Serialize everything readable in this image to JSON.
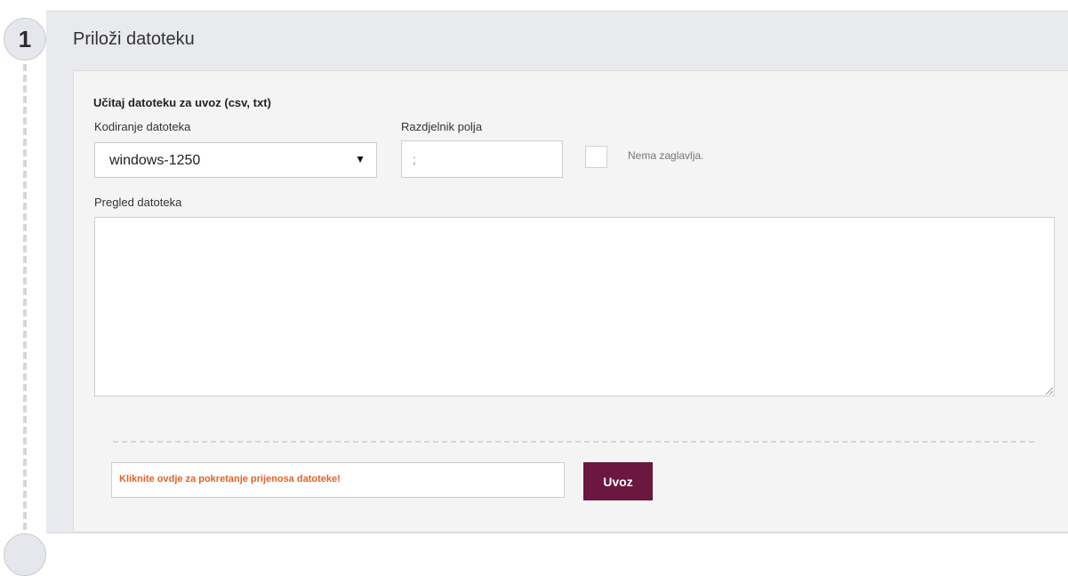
{
  "step": {
    "number": "1",
    "title": "Priloži datoteku"
  },
  "form": {
    "section_title": "Učitaj datoteku za uvoz (csv, txt)",
    "encoding": {
      "label": "Kodiranje datoteka",
      "value": "windows-1250",
      "icon": "caret-down-icon"
    },
    "separator": {
      "label": "Razdjelnik polja",
      "value": ";"
    },
    "no_header": {
      "label": "Nema zaglavlja.",
      "checked": false
    },
    "preview": {
      "label": "Pregled datoteka",
      "value": ""
    }
  },
  "upload": {
    "prompt": "Kliknite ovdje za pokretanje prijenosa datoteke!",
    "button_label": "Uvoz"
  },
  "colors": {
    "accent": "#6b1740",
    "upload_prompt": "#e0622a",
    "panel_bg": "#e9eaee"
  }
}
